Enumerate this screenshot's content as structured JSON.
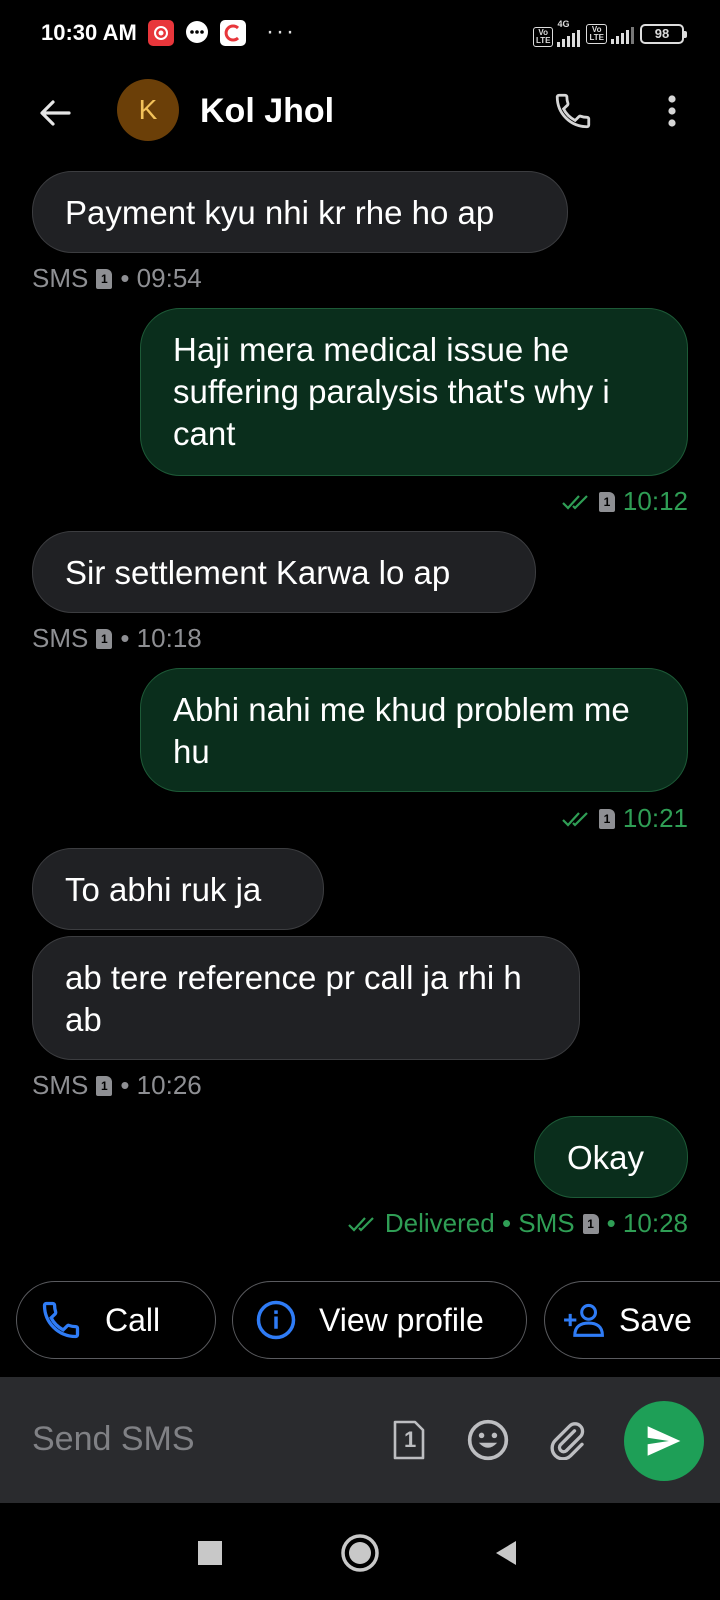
{
  "status_bar": {
    "time": "10:30 AM",
    "network_label": "4G",
    "volte_label": "Vo LTE",
    "battery": "98",
    "more_dots": "···"
  },
  "header": {
    "avatar_letter": "K",
    "contact_name": "Kol Jhol"
  },
  "messages": [
    {
      "direction": "in",
      "text": "Payment kyu nhi kr rhe ho ap",
      "meta": "SMS",
      "sim": "1",
      "time": "• 09:54"
    },
    {
      "direction": "out",
      "text": "Haji mera medical issue he suffering paralysis that's why i cant",
      "sim": "1",
      "time": "10:12"
    },
    {
      "direction": "in",
      "text": "Sir settlement Karwa lo ap",
      "meta": "SMS",
      "sim": "1",
      "time": "• 10:18"
    },
    {
      "direction": "out",
      "text": "Abhi nahi me khud problem me hu",
      "sim": "1",
      "time": "10:21"
    },
    {
      "direction": "in",
      "text": "To abhi ruk ja"
    },
    {
      "direction": "in",
      "text": "ab tere reference pr call ja rhi h ab",
      "meta": "SMS",
      "sim": "1",
      "time": "• 10:26"
    },
    {
      "direction": "out",
      "text": "Okay",
      "status": "Delivered • SMS",
      "sim": "1",
      "time": "• 10:28"
    }
  ],
  "chips": {
    "call": "Call",
    "view_profile": "View profile",
    "save": "Save"
  },
  "composer": {
    "placeholder": "Send SMS",
    "sim_label": "1"
  },
  "colors": {
    "accent_green": "#1e9f57",
    "out_bubble": "#0a2e1c",
    "in_bubble": "#202124",
    "chip_icon_blue": "#2f7cf6"
  }
}
